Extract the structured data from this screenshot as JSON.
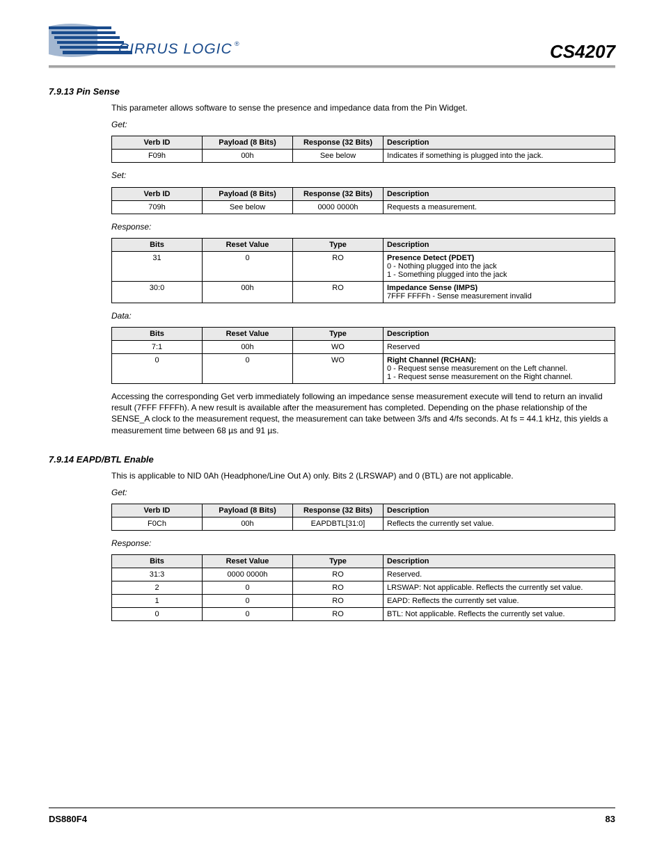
{
  "header": {
    "logo_alt": "Cirrus Logic",
    "part_number": "CS4207"
  },
  "section1": {
    "title": "7.9.13   Pin Sense",
    "intro": "This parameter allows software to sense the presence and impedance data from the Pin Widget.",
    "get_label": "Get:",
    "set_label": "Set:",
    "response_label": "Response:",
    "data_label": "Data:",
    "tables": {
      "get": {
        "headers": [
          "Verb ID",
          "Payload (8 Bits)",
          "Response (32 Bits)",
          "Description"
        ],
        "rows": [
          [
            "F09h",
            "00h",
            "See below",
            "Indicates if something is plugged into the jack."
          ]
        ]
      },
      "set": {
        "headers": [
          "Verb ID",
          "Payload (8 Bits)",
          "Response (32 Bits)",
          "Description"
        ],
        "rows": [
          [
            "709h",
            "See below",
            "0000 0000h",
            "Requests a measurement."
          ]
        ]
      },
      "response": {
        "headers": [
          "Bits",
          "Reset Value",
          "Type",
          "Description"
        ],
        "rows": [
          [
            "31",
            "0",
            "RO",
            "Presence Detect (PDET)\n0 - Nothing plugged into the jack\n1 - Something plugged into the jack"
          ],
          [
            "30:0",
            "00h",
            "RO",
            "Impedance Sense (IMPS)\n7FFF FFFFh - Sense measurement invalid"
          ]
        ]
      },
      "data": {
        "headers": [
          "Bits",
          "Reset Value",
          "Type",
          "Description"
        ],
        "rows": [
          [
            "7:1",
            "00h",
            "WO",
            "Reserved"
          ],
          [
            "0",
            "0",
            "WO",
            "Right Channel (RCHAN):\n0 - Request sense measurement on the Left channel.\n1 - Request sense measurement on the Right channel."
          ]
        ]
      }
    },
    "note": "Accessing the corresponding Get verb immediately following an impedance sense measurement execute will tend to return an invalid result (7FFF FFFFh). A new result is available after the measurement has completed. Depending on the phase relationship of the SENSE_A clock to the measurement request, the measurement can take between 3/fs and 4/fs seconds. At fs = 44.1 kHz, this yields a measurement time between 68 µs and 91 µs."
  },
  "section2": {
    "title": "7.9.14   EAPD/BTL Enable",
    "intro": "This is applicable to NID 0Ah (Headphone/Line Out A) only. Bits 2 (LRSWAP) and 0 (BTL) are not applicable.",
    "get_label": "Get:",
    "response_label": "Response:",
    "tables": {
      "get": {
        "headers": [
          "Verb ID",
          "Payload (8 Bits)",
          "Response (32 Bits)",
          "Description"
        ],
        "rows": [
          [
            "F0Ch",
            "00h",
            "EAPDBTL[31:0]",
            "Reflects the currently set value."
          ]
        ]
      },
      "response": {
        "headers": [
          "Bits",
          "Reset Value",
          "Type",
          "Description"
        ],
        "rows": [
          [
            "31:3",
            "0000 0000h",
            "RO",
            "Reserved."
          ],
          [
            "2",
            "0",
            "RO",
            "LRSWAP: Not applicable. Reflects the currently set value."
          ],
          [
            "1",
            "0",
            "RO",
            "EAPD: Reflects the currently set value."
          ],
          [
            "0",
            "0",
            "RO",
            "BTL: Not applicable. Reflects the currently set value."
          ]
        ]
      }
    }
  },
  "footer": {
    "doc_id": "DS880F4",
    "page_no": "83"
  }
}
